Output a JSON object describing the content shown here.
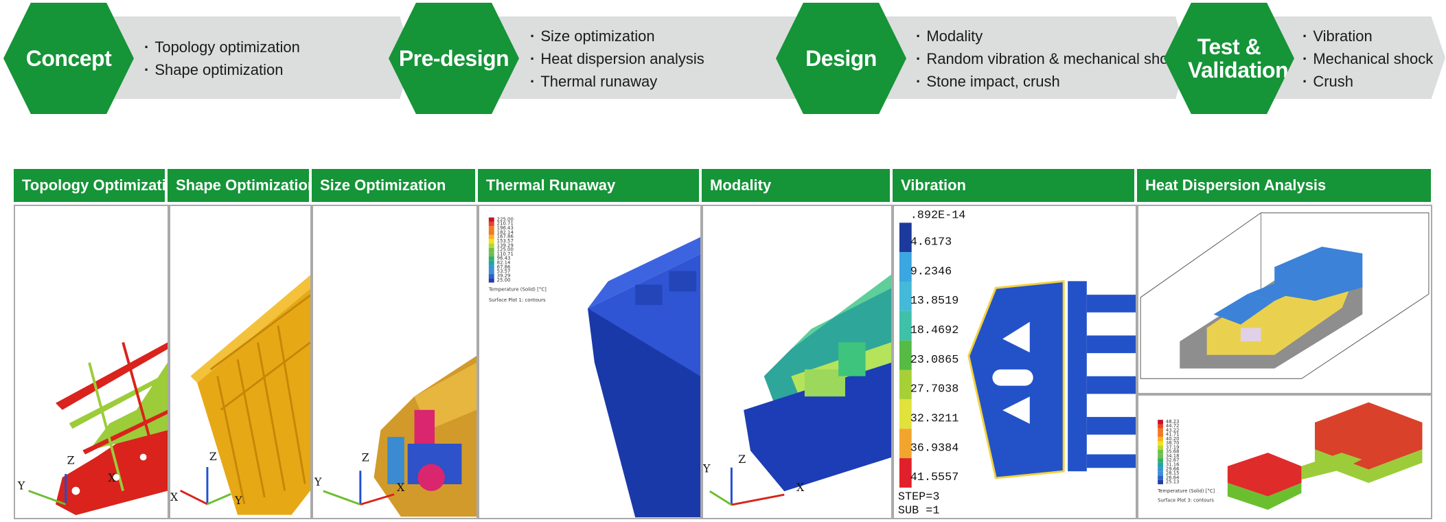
{
  "process": {
    "stages": [
      {
        "name": "Concept",
        "bullets": [
          "Topology optimization",
          "Shape optimization"
        ]
      },
      {
        "name": "Pre-design",
        "bullets": [
          "Size optimization",
          "Heat dispersion analysis",
          "Thermal runaway"
        ]
      },
      {
        "name": "Design",
        "bullets": [
          "Modality",
          "Random vibration & mechanical shock",
          "Stone impact, crush"
        ]
      },
      {
        "name": "Test & Validation",
        "bullets": [
          "Vibration",
          "Mechanical shock",
          "Crush"
        ]
      }
    ]
  },
  "panels": [
    {
      "title": "Topology Optimization"
    },
    {
      "title": "Shape Optimization"
    },
    {
      "title": "Size Optimization"
    },
    {
      "title": "Thermal Runaway"
    },
    {
      "title": "Modality"
    },
    {
      "title": "Vibration"
    },
    {
      "title": "Heat Dispersion Analysis"
    }
  ],
  "axes": {
    "x": "X",
    "y": "Y",
    "z": "Z"
  },
  "thermal": {
    "legend_values": [
      "225.00",
      "210.71",
      "196.43",
      "182.14",
      "167.86",
      "153.57",
      "139.29",
      "125.00",
      "110.71",
      "96.43",
      "82.14",
      "67.86",
      "53.57",
      "39.29",
      "25.00"
    ],
    "legend_caption": "Temperature (Solid) [°C]",
    "surface_caption": "Surface Plot 1: contours"
  },
  "vibration": {
    "legend_top": ".892E-14",
    "legend_values": [
      "4.6173",
      "9.2346",
      "13.8519",
      "18.4692",
      "23.0865",
      "27.7038",
      "32.3211",
      "36.9384",
      "41.5557"
    ],
    "step": "STEP=3",
    "sub": "SUB =1"
  },
  "heat": {
    "legend_values": [
      "48.23",
      "44.72",
      "43.22",
      "41.71",
      "40.20",
      "38.70",
      "37.19",
      "35.68",
      "34.18",
      "32.67",
      "31.16",
      "29.66",
      "28.15",
      "26.64",
      "25.13"
    ],
    "legend_caption": "Temperature (Solid) [°C]",
    "surface_caption": "Surface Plot 3: contours"
  },
  "colors": {
    "brand_green": "#159438",
    "arrow_grey": "#dcdddd",
    "panel_border": "#a9a9a9"
  }
}
